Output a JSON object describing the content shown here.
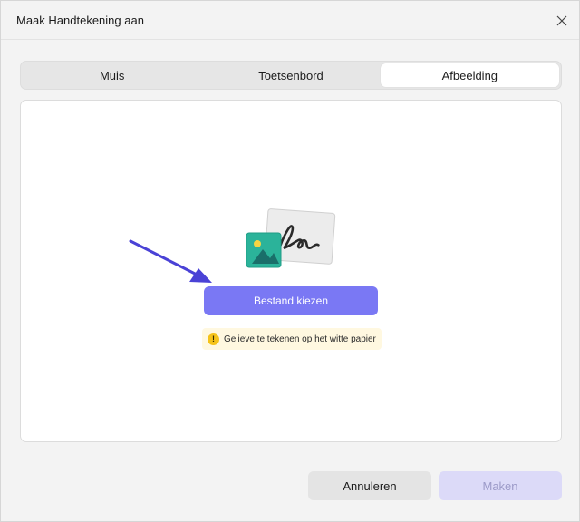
{
  "dialog": {
    "title": "Maak Handtekening aan",
    "close_icon": "close-icon"
  },
  "tabs": [
    {
      "label": "Muis",
      "active": false
    },
    {
      "label": "Toetsenbord",
      "active": false
    },
    {
      "label": "Afbeelding",
      "active": true
    }
  ],
  "panel": {
    "illustration_icon": "signature-image-icon",
    "choose_file_label": "Bestand kiezen",
    "hint_text": "Gelieve te tekenen op het witte papier",
    "hint_icon": "warning-icon"
  },
  "footer": {
    "cancel_label": "Annuleren",
    "create_label": "Maken"
  },
  "colors": {
    "accent": "#7a78f4",
    "annotation_arrow": "#4a42d6",
    "hint_bg": "#fff8e0"
  }
}
